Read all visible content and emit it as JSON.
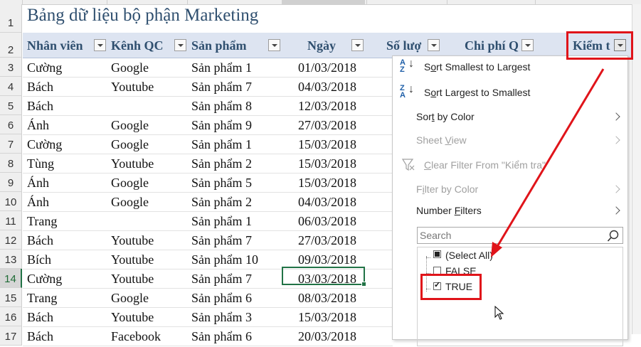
{
  "title": "Bảng dữ liệu bộ phận Marketing",
  "row_numbers": [
    "1",
    "2",
    "3",
    "4",
    "5",
    "6",
    "7",
    "8",
    "9",
    "10",
    "11",
    "12",
    "13",
    "14",
    "15",
    "16",
    "17"
  ],
  "selected_row": "14",
  "headers": [
    {
      "label": "Nhân viên"
    },
    {
      "label": "Kênh QC"
    },
    {
      "label": "Sản phẩm"
    },
    {
      "label": "Ngày"
    },
    {
      "label": "Số lượ"
    },
    {
      "label": "Chi phí Q"
    },
    {
      "label": "Kiểm t"
    }
  ],
  "rows": [
    {
      "nv": "Cường",
      "kenh": "Google",
      "sp": "Sản phẩm 1",
      "ngay": "01/03/2018"
    },
    {
      "nv": "Bách",
      "kenh": "Youtube",
      "sp": "Sản phẩm 7",
      "ngay": "04/03/2018"
    },
    {
      "nv": "Bách",
      "kenh": "",
      "sp": "Sản phẩm 8",
      "ngay": "12/03/2018"
    },
    {
      "nv": "Ánh",
      "kenh": "Google",
      "sp": "Sản phẩm 9",
      "ngay": "27/03/2018"
    },
    {
      "nv": "Cường",
      "kenh": "Google",
      "sp": "Sản phẩm 1",
      "ngay": "15/03/2018"
    },
    {
      "nv": "Tùng",
      "kenh": "Youtube",
      "sp": "Sản phẩm 2",
      "ngay": "15/03/2018"
    },
    {
      "nv": "Ánh",
      "kenh": "Google",
      "sp": "Sản phẩm 5",
      "ngay": "15/03/2018"
    },
    {
      "nv": "Ánh",
      "kenh": "Google",
      "sp": "Sản phẩm 2",
      "ngay": "04/03/2018"
    },
    {
      "nv": "Trang",
      "kenh": "",
      "sp": "Sản phẩm 1",
      "ngay": "06/03/2018"
    },
    {
      "nv": "Bách",
      "kenh": "Youtube",
      "sp": "Sản phẩm 7",
      "ngay": "27/03/2018"
    },
    {
      "nv": "Bích",
      "kenh": "Youtube",
      "sp": "Sản phẩm 10",
      "ngay": "09/03/2018"
    },
    {
      "nv": "Cường",
      "kenh": "Youtube",
      "sp": "Sản phẩm 7",
      "ngay": "03/03/2018"
    },
    {
      "nv": "Trang",
      "kenh": "Google",
      "sp": "Sản phẩm 6",
      "ngay": "08/03/2018"
    },
    {
      "nv": "Bách",
      "kenh": "Youtube",
      "sp": "Sản phẩm 3",
      "ngay": "15/03/2018"
    },
    {
      "nv": "Bách",
      "kenh": "Facebook",
      "sp": "Sản phẩm 6",
      "ngay": "20/03/2018"
    }
  ],
  "menu": {
    "sort_asc_pre": "S",
    "sort_asc_u": "o",
    "sort_asc_post": "rt Smallest to Largest",
    "sort_desc_pre": "S",
    "sort_desc_u": "o",
    "sort_desc_post": "rt Largest to Smallest",
    "sort_color_pre": "Sor",
    "sort_color_u": "t",
    "sort_color_post": " by Color",
    "sheet_view_pre": "Sheet ",
    "sheet_view_u": "V",
    "sheet_view_post": "iew",
    "clear_filter_pre": "",
    "clear_filter_u": "C",
    "clear_filter_post": "lear Filter From \"Kiểm tra\"",
    "filter_color_pre": "F",
    "filter_color_u": "i",
    "filter_color_post": "lter by Color",
    "number_filters_pre": "Number ",
    "number_filters_u": "F",
    "number_filters_post": "ilters",
    "search_placeholder": "Search",
    "list": [
      "(Select All)",
      "FALSE",
      "TRUE"
    ]
  },
  "colors": {
    "annotation": "#e0141a",
    "header_fill": "#dde4f1",
    "active_cell": "#217346"
  }
}
